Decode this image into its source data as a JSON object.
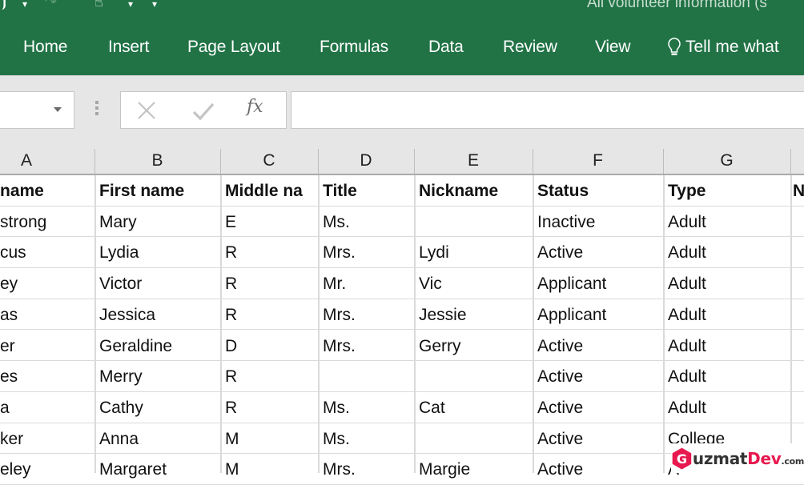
{
  "window": {
    "title": "All volunteer information (s",
    "quick_access": [
      "save-icon",
      "undo-icon",
      "redo-icon",
      "touch-mode-icon",
      "customize-dropdown-icon"
    ]
  },
  "ribbon": {
    "tabs": [
      "Home",
      "Insert",
      "Page Layout",
      "Formulas",
      "Data",
      "Review",
      "View"
    ],
    "tell_me": "Tell me what",
    "accent_color": "#217346"
  },
  "formula_bar": {
    "name_box_value": "",
    "cancel_icon": "cancel-icon",
    "enter_icon": "enter-icon",
    "fx_label": "fx",
    "formula_value": ""
  },
  "sheet": {
    "column_letters": [
      "A",
      "B",
      "C",
      "D",
      "E",
      "F",
      "G",
      ""
    ],
    "headers": [
      "name",
      "First name",
      "Middle na",
      "Title",
      "Nickname",
      "Status",
      "Type",
      "N"
    ],
    "rows": [
      [
        "strong",
        "Mary",
        "E",
        "Ms.",
        "",
        "Inactive",
        "Adult",
        ""
      ],
      [
        "cus",
        "Lydia",
        "R",
        "Mrs.",
        "Lydi",
        "Active",
        "Adult",
        ""
      ],
      [
        "ey",
        "Victor",
        "R",
        "Mr.",
        "Vic",
        "Applicant",
        "Adult",
        ""
      ],
      [
        "as",
        "Jessica",
        "R",
        "Mrs.",
        "Jessie",
        "Applicant",
        "Adult",
        ""
      ],
      [
        "er",
        "Geraldine",
        "D",
        "Mrs.",
        "Gerry",
        "Active",
        "Adult",
        ""
      ],
      [
        "es",
        "Merry",
        "R",
        "",
        "",
        "Active",
        "Adult",
        ""
      ],
      [
        "a",
        "Cathy",
        "R",
        "Ms.",
        "Cat",
        "Active",
        "Adult",
        ""
      ],
      [
        "ker",
        "Anna",
        "M",
        "Ms.",
        "",
        "Active",
        "College",
        ""
      ],
      [
        "eley",
        "Margaret",
        "M",
        "Mrs.",
        "Margie",
        "Active",
        "A",
        ""
      ]
    ]
  },
  "watermark": {
    "letter": "G",
    "text_main": "uzmat",
    "text_accent": "Dev",
    "text_suffix": ".com",
    "accent_color": "#e8194f"
  }
}
